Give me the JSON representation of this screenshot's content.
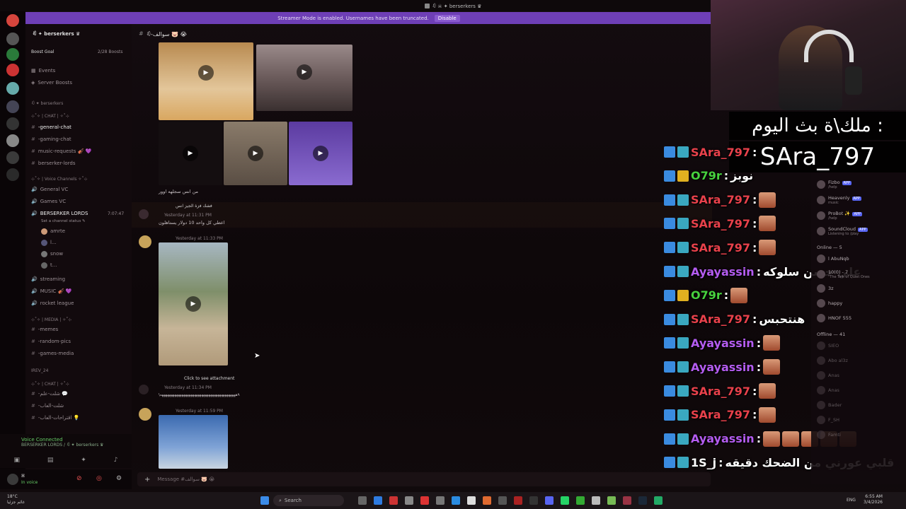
{
  "window": {
    "title": "ꀒ ☠ ✦ berserkers ♛"
  },
  "streamer_banner": {
    "text": "Streamer Mode is enabled. Usernames have been truncated.",
    "button": "Disable"
  },
  "server": {
    "name": "ꀒ ✦ berserkers ♛",
    "boost_goal": "Boost Goal",
    "boosts": "2/28 Boosts",
    "nav": [
      "Events",
      "Server Boosts"
    ],
    "category_server": "ꀒ ✦ berserkers",
    "cat_chat": "⊹˚✧ | CHAT | ✧˚⊹",
    "channels_chat": [
      "-general-chat",
      "-gaming-chat",
      "music-requests 🎻 💜",
      "berserker-lords"
    ],
    "cat_voice": "⊹˚✧ | Voice Channels ✧˚⊹",
    "voice_channels": [
      "General VC",
      "Games VC"
    ],
    "voice_active": "BERSERKER LORDS",
    "voice_timer": "7:07:47",
    "voice_status": "Set a channel status ✎",
    "voice_users": [
      "amrte",
      "l...",
      "snow",
      "t..."
    ],
    "channels_more": [
      "streaming",
      "MUSIC 🎻 💜",
      "rocket league"
    ],
    "cat_media": "⊹˚✧ | MEDIA | ✧˚⊹",
    "channels_media": [
      "-memes",
      "-random-pics",
      "-games-media"
    ],
    "cat_irev": "IREV_24",
    "cat_chat2": "⊹˚✧ | CHAT | ✧˚⊹",
    "channels_chat2": [
      "-شلت-علم 💬",
      "-شلت-العاب",
      "-اقتراحات-العاب 💡"
    ]
  },
  "voice_connected": {
    "label": "Voice Connected",
    "detail": "BERSERKER LORDS / ꀒ ✦ berserkers ♛"
  },
  "user": {
    "name": "ꕤ",
    "status": "In voice"
  },
  "chat": {
    "channel": "ꀒ-سوالف 🐷 😭",
    "caption_1": "من انس سجلهه اوور",
    "reply_name": "فشك فزة الجيز انس",
    "reply_time": "Yesterday at 11:31 PM",
    "reply_text": "اعطي كل واحد 10 دولار يستاهلون",
    "msg2_time": "Yesterday at 11:33 PM",
    "msg3_attach": "Click to see attachment",
    "msg3_time": "Yesterday at 11:34 PM",
    "msg3_text": "\\٩ههههههههههههههههههههههههههههههههههههههههههه",
    "msg4_time": "Yesterday at 11:59 PM",
    "composer_placeholder": "Message #سوالف 🐷 😭"
  },
  "stream_overlay": {
    "title_line": "ملك\\ة بث اليوم :",
    "winner": "SAra_797",
    "messages": [
      {
        "user": "SAra_797",
        "text": "",
        "color": "#e8414b",
        "emotes": 0
      },
      {
        "user": "O79r",
        "text": "نوبز",
        "color": "#47d13e",
        "emotes": 0
      },
      {
        "user": "SAra_797",
        "text": "",
        "color": "#e8414b",
        "emotes": 1
      },
      {
        "user": "SAra_797",
        "text": "",
        "color": "#e8414b",
        "emotes": 1
      },
      {
        "user": "SAra_797",
        "text": "",
        "color": "#e8414b",
        "emotes": 1
      },
      {
        "user": "Ayayassin",
        "text": "علي حسن سلوكه",
        "color": "#b45cf0",
        "emotes": 0
      },
      {
        "user": "O79r",
        "text": "",
        "color": "#47d13e",
        "emotes": 1
      },
      {
        "user": "SAra_797",
        "text": "هنتحبس",
        "color": "#e8414b",
        "emotes": 0
      },
      {
        "user": "Ayayassin",
        "text": "",
        "color": "#b45cf0",
        "emotes": 1
      },
      {
        "user": "Ayayassin",
        "text": "",
        "color": "#b45cf0",
        "emotes": 1
      },
      {
        "user": "SAra_797",
        "text": "",
        "color": "#e8414b",
        "emotes": 1
      },
      {
        "user": "SAra_797",
        "text": "",
        "color": "#e8414b",
        "emotes": 1
      },
      {
        "user": "Ayayassin",
        "text": "",
        "color": "#b45cf0",
        "emotes": 5
      },
      {
        "user": "1S_j",
        "text": "قلبي عورني من الضحك دقيقه",
        "color": "#ffffff",
        "emotes": 0
      }
    ]
  },
  "members": {
    "bots": [
      {
        "name": "Fizbo",
        "tag": "APP",
        "sub": "/help"
      },
      {
        "name": "Heavenly",
        "tag": "APP",
        "sub": "music"
      },
      {
        "name": "ProBot ✨",
        "tag": "APP",
        "sub": "/help"
      },
      {
        "name": "SoundCloud",
        "tag": "APP",
        "sub": "Listening to /play"
      }
    ],
    "online_header": "Online — 5",
    "online": [
      {
        "name": "l AbuNqb",
        "sub": ""
      },
      {
        "name": "10(0) - 7",
        "sub": "\"The Talk of Quiet Ones"
      },
      {
        "name": "3z",
        "sub": ""
      },
      {
        "name": "happy",
        "sub": ""
      },
      {
        "name": "HNOF 555",
        "sub": ""
      }
    ],
    "offline_header": "Offline — 41",
    "offline": [
      "SIEO",
      "Abo al3z",
      "Anas",
      "Anas",
      "Bader",
      "F_SH",
      "Famti"
    ]
  },
  "taskbar": {
    "weather_temp": "18°C",
    "weather_desc": "غائم جزئيا",
    "search": "Search",
    "lang": "ENG",
    "time": "6:55 AM",
    "date": "3/4/2026"
  }
}
